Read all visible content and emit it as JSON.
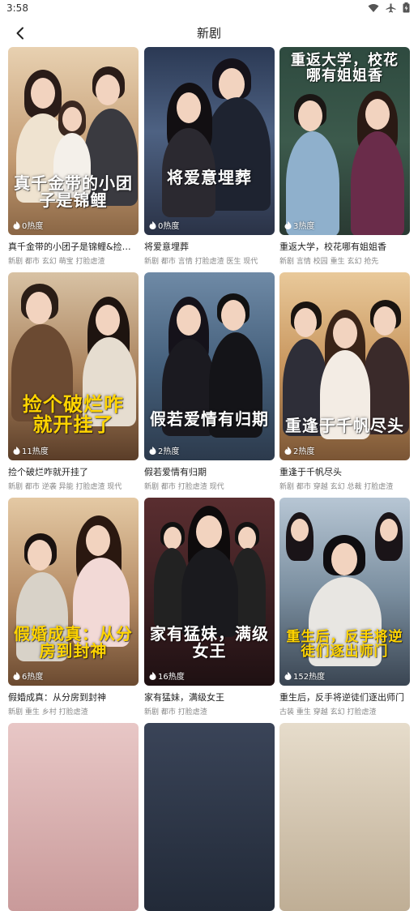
{
  "status": {
    "time": "3:58"
  },
  "header": {
    "title": "新剧"
  },
  "dramas": [
    {
      "title": "真千金带的小团子是锦鲤&捡个...",
      "poster_text": "真千金带的小团子是锦鲤",
      "heat": "0热度",
      "tags": "新剧 都市 玄幻 萌宝 打脸虐渣",
      "bg": "#c9a27a"
    },
    {
      "title": "将爱意埋葬",
      "poster_text": "将爱意埋葬",
      "heat": "0热度",
      "tags": "新剧 都市 言情 打脸虐渣 医生 现代",
      "bg": "#3b4a66"
    },
    {
      "title": "重返大学，校花哪有姐姐香",
      "poster_text": "重返大学，校花哪有姐姐香",
      "heat": "3热度",
      "tags": "新剧 言情 校园 重生 玄幻 抢先",
      "bg": "#2f4a3e"
    },
    {
      "title": "捡个破烂咋就开挂了",
      "poster_text": "捡个破烂咋就开挂了",
      "heat": "11热度",
      "tags": "新剧 都市 逆袭 异能 打脸虐渣 现代",
      "bg": "#a8805a"
    },
    {
      "title": "假若爱情有归期",
      "poster_text": "假若爱情有归期",
      "heat": "2热度",
      "tags": "新剧 都市 打脸虐渣 现代",
      "bg": "#4f6b86"
    },
    {
      "title": "重逢于千帆尽头",
      "poster_text": "重逢于千帆尽头",
      "heat": "2热度",
      "tags": "新剧 都市 穿越 玄幻 总裁 打脸虐渣",
      "bg": "#b98a54"
    },
    {
      "title": "假婚成真：从分房到封神",
      "poster_text": "假婚成真：从分房到封神",
      "heat": "6热度",
      "tags": "新剧 重生 乡村 打脸虐渣",
      "bg": "#b58b64"
    },
    {
      "title": "家有猛妹，满级女王",
      "poster_text": "家有猛妹，满级女王",
      "heat": "16热度",
      "tags": "新剧 都市 打脸虐渣",
      "bg": "#4a2a2c"
    },
    {
      "title": "重生后，反手将逆徒们逐出师门",
      "poster_text": "重生后，反手将逆徒们逐出师门",
      "heat": "152热度",
      "tags": "古装 重生 穿越 玄幻 打脸虐渣",
      "bg": "#7b8fa0"
    }
  ]
}
